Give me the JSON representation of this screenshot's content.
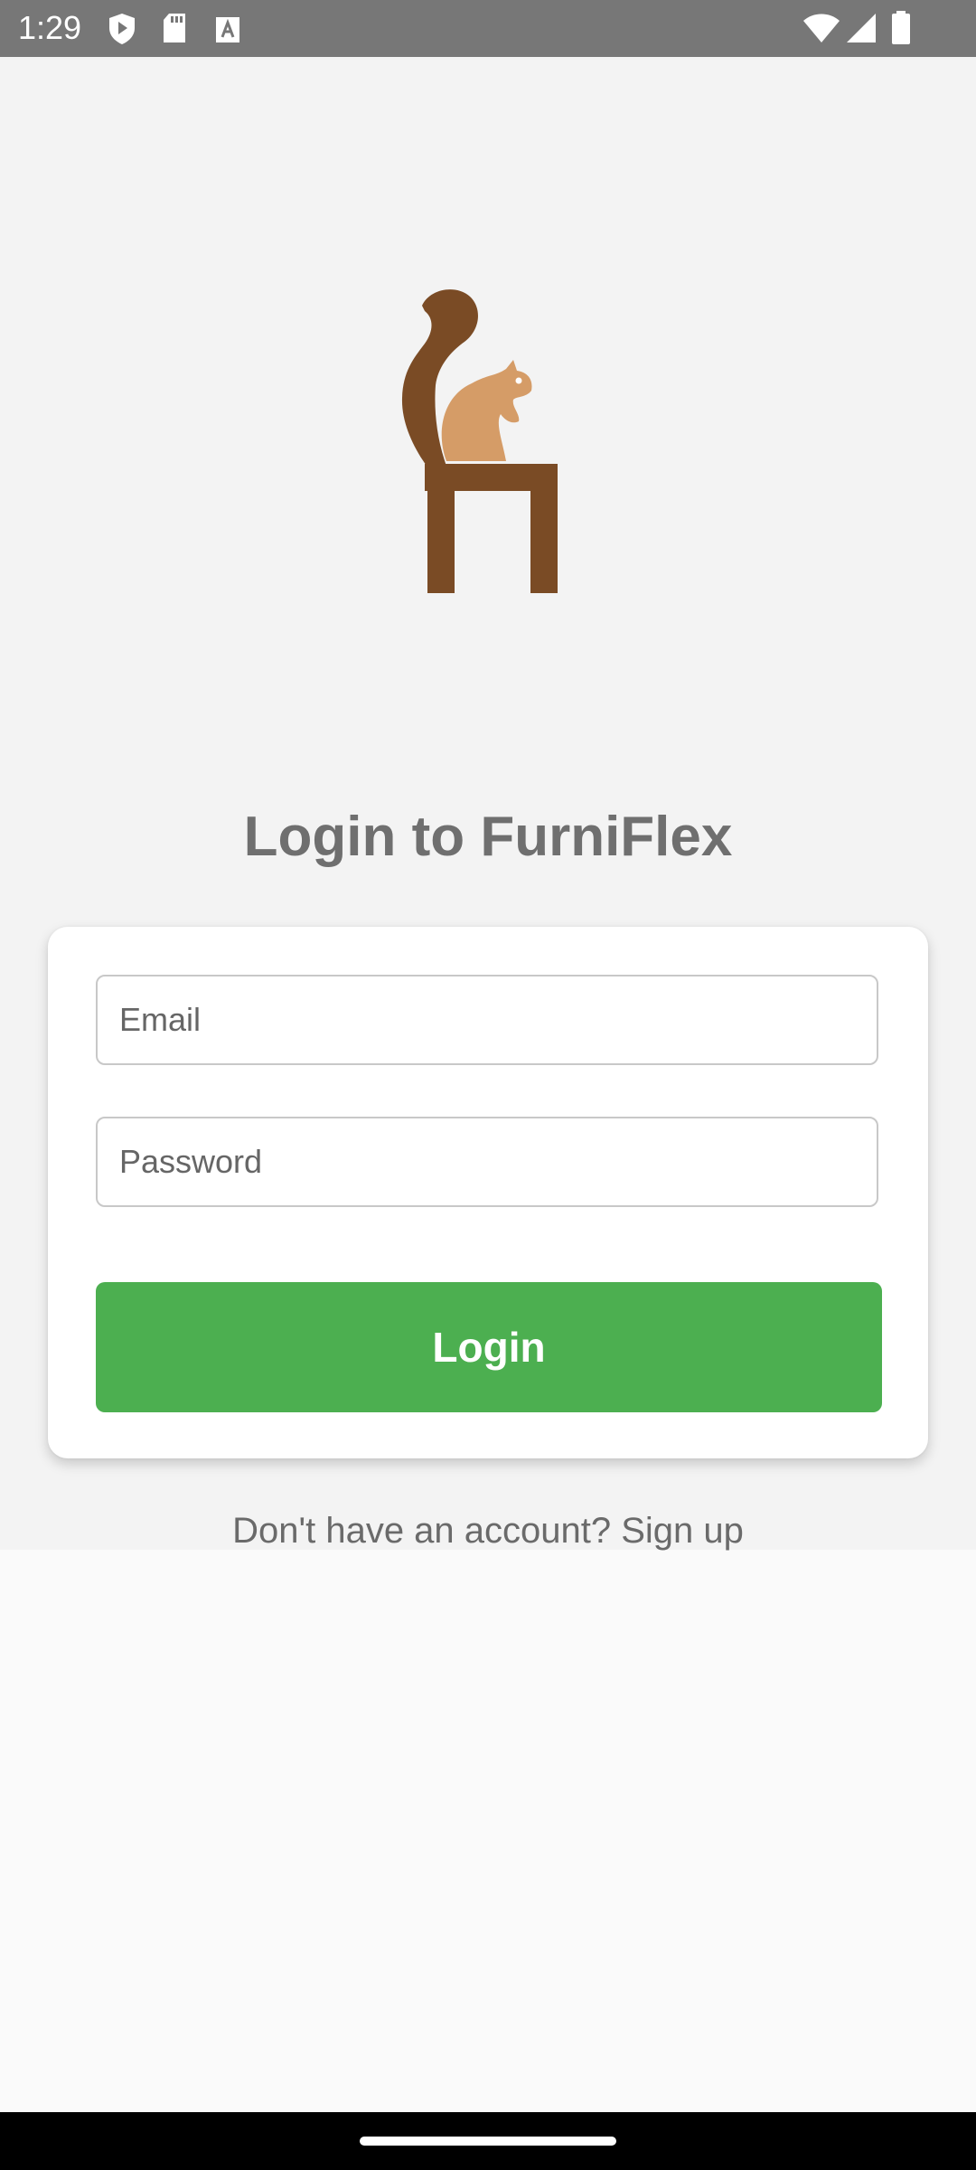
{
  "status_bar": {
    "time": "1:29",
    "icons_left": [
      "shield-icon",
      "sd-card-icon",
      "font-a-icon"
    ],
    "icons_right": [
      "wifi-icon",
      "signal-icon",
      "battery-icon"
    ]
  },
  "logo": {
    "icon": "squirrel-chair-logo",
    "colors": {
      "dark": "#7a4b25",
      "light": "#d59c67"
    }
  },
  "title": "Login to FurniFlex",
  "form": {
    "email_placeholder": "Email",
    "password_placeholder": "Password",
    "login_label": "Login"
  },
  "signup_text": "Don't have an account? Sign up",
  "colors": {
    "primary": "#4caf50",
    "title": "#6f6f6f",
    "background": "#f3f3f3"
  }
}
